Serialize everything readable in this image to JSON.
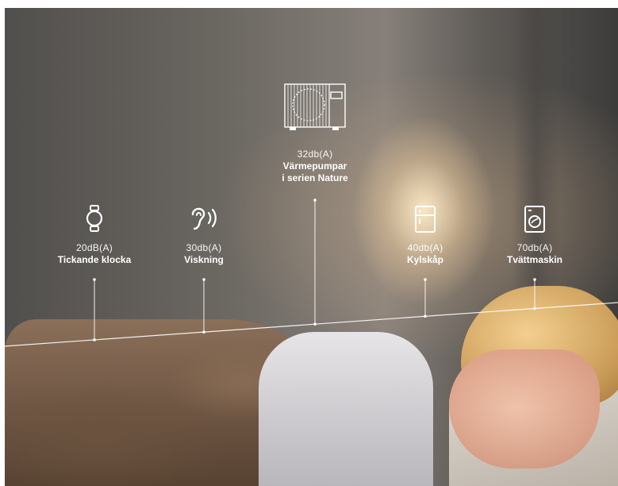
{
  "chart_data": {
    "type": "line",
    "title": "",
    "series_color": "#ffffff",
    "points": [
      {
        "value": "20dB(A)",
        "label": "Tickande klocka",
        "icon": "clock-icon"
      },
      {
        "value": "30db(A)",
        "label": "Viskning",
        "icon": "ear-icon"
      },
      {
        "value": "32db(A)",
        "label": "Värmepumpar\ni serien Nature",
        "icon": "heat-pump-icon"
      },
      {
        "value": "40db(A)",
        "label": "Kylskåp",
        "icon": "fridge-icon"
      },
      {
        "value": "70db(A)",
        "label": "Tvättmaskin",
        "icon": "washing-machine-icon"
      }
    ]
  },
  "colors": {
    "text": "#ffffff",
    "line": "#ffffff"
  }
}
